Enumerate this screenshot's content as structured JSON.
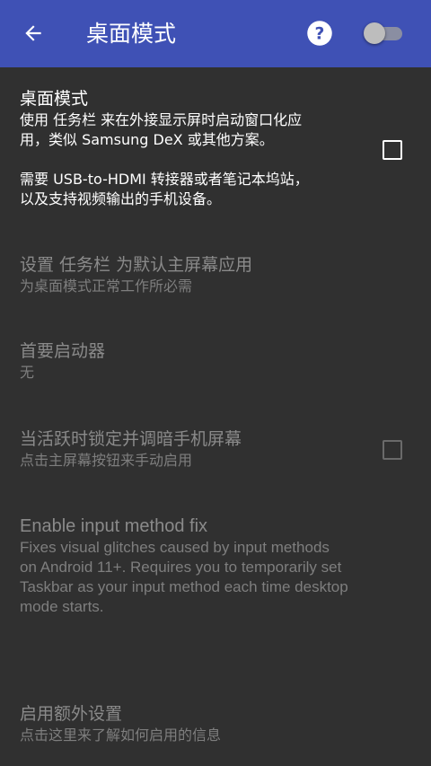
{
  "toolbar": {
    "back_icon": "arrow-back-icon",
    "title": "桌面模式",
    "help_icon": "help-circle-icon",
    "toggle_on": false,
    "accent": "#3F51B5"
  },
  "prefs": {
    "desktop_mode": {
      "title": "桌面模式",
      "summary_lines": [
        "使用 任务栏 来在外接显示屏时启动窗口化应",
        "用，类似 Samsung DeX 或其他方案。",
        "需要 USB-to-HDMI 转接器或者笔记本坞站，",
        "以及支持视频输出的手机设备。"
      ],
      "checked": false,
      "enabled": true
    },
    "default_home": {
      "title": "设置 任务栏 为默认主屏幕应用",
      "summary": "为桌面模式正常工作所必需",
      "enabled": false
    },
    "primary_launcher": {
      "title": "首要启动器",
      "summary": "无",
      "enabled": false
    },
    "dim_screen": {
      "title": "当活跃时锁定并调暗手机屏幕",
      "summary": "点击主屏幕按钮来手动启用",
      "checked": false,
      "enabled": false
    },
    "input_method_fix": {
      "title": "Enable input method fix",
      "summary_lines": [
        "Fixes visual glitches caused by input methods",
        "on Android 11+. Requires you to temporarily set",
        "Taskbar as your input method each time desktop",
        "mode starts."
      ],
      "enabled": false
    },
    "extra_settings": {
      "title": "启用额外设置",
      "summary": "点击这里来了解如何启用的信息",
      "enabled": false
    }
  },
  "colors": {
    "background": "#303030",
    "text_primary": "#ffffff",
    "text_disabled": "#8a8a8a"
  }
}
